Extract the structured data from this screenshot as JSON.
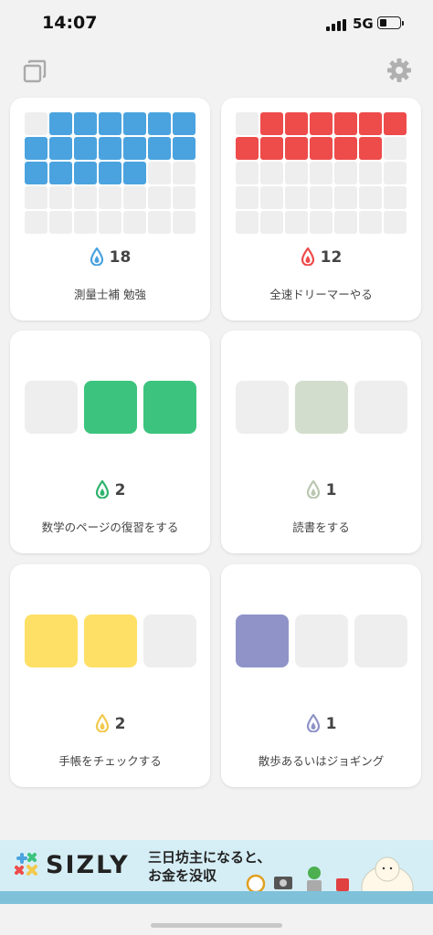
{
  "status_bar": {
    "time": "14:07",
    "network": "5G"
  },
  "colors": {
    "empty_cell": "#eeeeee",
    "blue": "#4aa3df",
    "red": "#ee4b4b",
    "green": "#3cc47e",
    "sage": "#d3ddcd",
    "yellow": "#ffe066",
    "purple": "#8f93c8"
  },
  "habits": [
    {
      "name": "測量士補 勉強",
      "count": "18",
      "color": "#4aa3df",
      "icon_color": "#4aa3df",
      "display": "grid35",
      "filled_indices": [
        1,
        2,
        3,
        4,
        5,
        6,
        7,
        8,
        9,
        10,
        11,
        12,
        13,
        14,
        15,
        16,
        17,
        18
      ]
    },
    {
      "name": "全速ドリーマーやる",
      "count": "12",
      "color": "#ee4b4b",
      "icon_color": "#ee4b4b",
      "display": "grid35",
      "filled_indices": [
        1,
        2,
        3,
        4,
        5,
        6,
        7,
        8,
        9,
        10,
        11,
        12
      ]
    },
    {
      "name": "数学のページの復習をする",
      "count": "2",
      "color": "#3cc47e",
      "icon_color": "#2fb36d",
      "display": "three",
      "filled_indices": [
        1,
        2
      ]
    },
    {
      "name": "読書をする",
      "count": "1",
      "color": "#d3ddcd",
      "icon_color": "#b9c7b1",
      "display": "three",
      "filled_indices": [
        1
      ]
    },
    {
      "name": "手帳をチェックする",
      "count": "2",
      "color": "#ffe066",
      "icon_color": "#f2c94c",
      "display": "three",
      "filled_indices": [
        0,
        1
      ]
    },
    {
      "name": "散歩あるいはジョギング",
      "count": "1",
      "color": "#8f93c8",
      "icon_color": "#8f93c8",
      "display": "three",
      "filled_indices": [
        0
      ]
    }
  ],
  "ad": {
    "brand": "SIZLY",
    "line1": "三日坊主になると、",
    "line2": "お金を没収"
  },
  "icons": {
    "top_left": "copy-icon",
    "top_right": "gear-icon",
    "habit_icon": "drop-icon"
  }
}
